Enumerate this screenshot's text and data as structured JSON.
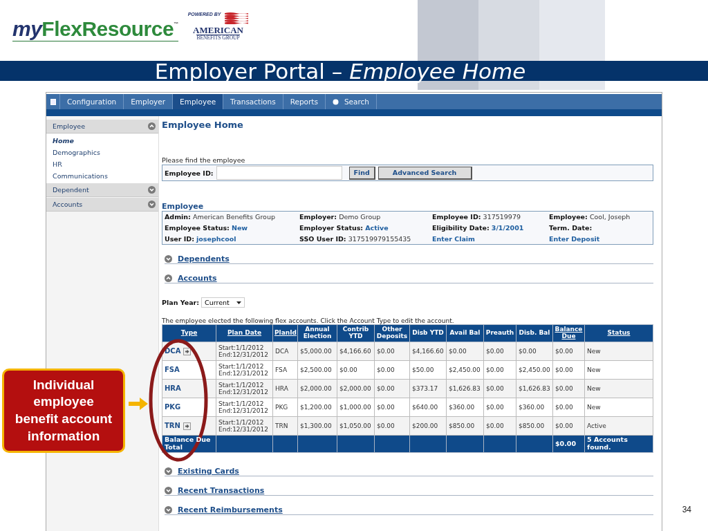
{
  "slide": {
    "logo": {
      "prefix": "my",
      "name": "FlexResource",
      "tm": "™"
    },
    "powered_by": "POWERED BY",
    "partner": [
      "AMERICAN",
      "BENEFITS GROUP"
    ],
    "title": "Employer Portal",
    "dash": "–",
    "subtitle": "Employee Home",
    "page_number": "34"
  },
  "callout": {
    "text": "Individual employee benefit account information"
  },
  "nav": {
    "tabs": [
      {
        "label": "Configuration",
        "selected": false,
        "kind": "tab"
      },
      {
        "label": "Employer",
        "selected": false,
        "kind": "tab"
      },
      {
        "label": "Employee",
        "selected": true,
        "kind": "tab"
      },
      {
        "label": "Transactions",
        "selected": false,
        "kind": "tab"
      },
      {
        "label": "Reports",
        "selected": false,
        "kind": "tab"
      },
      {
        "label": "Search",
        "selected": false,
        "kind": "search"
      }
    ]
  },
  "sidebar": {
    "groups": [
      {
        "label": "Employee",
        "expanded": true,
        "items": [
          {
            "label": "Home",
            "selected": true
          },
          {
            "label": "Demographics",
            "selected": false
          },
          {
            "label": "HR",
            "selected": false
          },
          {
            "label": "Communications",
            "selected": false
          }
        ]
      },
      {
        "label": "Dependent",
        "expanded": false
      },
      {
        "label": "Accounts",
        "expanded": false
      }
    ]
  },
  "content": {
    "heading": "Employee Home",
    "find": {
      "prompt": "Please find the employee",
      "label": "Employee ID:",
      "find_button": "Find",
      "advanced_button": "Advanced Search"
    },
    "employee": {
      "heading": "Employee",
      "fields": [
        {
          "label": "Admin:",
          "value": "American Benefits Group",
          "kind": "text"
        },
        {
          "label": "Employer:",
          "value": "Demo Group",
          "kind": "text"
        },
        {
          "label": "Employee ID:",
          "value": "317519979",
          "kind": "text"
        },
        {
          "label": "Employee:",
          "value": "Cool, Joseph",
          "kind": "text"
        },
        {
          "label": "Employee Status:",
          "value": "New",
          "kind": "status"
        },
        {
          "label": "Employer Status:",
          "value": "Active",
          "kind": "status"
        },
        {
          "label": "Eligibility Date:",
          "value": "3/1/2001",
          "kind": "status"
        },
        {
          "label": "Term. Date:",
          "kind": "text"
        },
        {
          "label": "User ID:",
          "value": "josephcool",
          "kind": "status"
        },
        {
          "label": "SSO User ID:",
          "value": "317519979155435",
          "kind": "text"
        },
        {
          "value": "Enter Claim",
          "kind": "link"
        },
        {
          "value": "Enter Deposit",
          "kind": "link"
        }
      ]
    },
    "sections": [
      {
        "label": "Dependents",
        "expanded": false
      },
      {
        "label": "Accounts",
        "expanded": true
      }
    ],
    "plan_year": {
      "label": "Plan Year:",
      "value": "Current"
    },
    "accounts_note": "The employee elected the following flex accounts. Click the Account Type to edit the account.",
    "table": {
      "columns": [
        {
          "label": "Type",
          "underlined": true
        },
        {
          "label": "Plan Date",
          "underlined": true
        },
        {
          "label": "PlanId",
          "underlined": true
        },
        {
          "label": "Annual Election",
          "underlined": false
        },
        {
          "label": "Contrib YTD",
          "underlined": false
        },
        {
          "label": "Other Deposits",
          "underlined": false
        },
        {
          "label": "Disb YTD",
          "underlined": false
        },
        {
          "label": "Avail Bal",
          "underlined": false
        },
        {
          "label": "Preauth",
          "underlined": false
        },
        {
          "label": "Disb. Bal",
          "underlined": false
        },
        {
          "label": "Balance Due",
          "underlined": true
        },
        {
          "label": "Status",
          "underlined": true
        }
      ],
      "rows": [
        {
          "add_icon": true,
          "cells": [
            "DCA",
            "Start:1/1/2012\nEnd:12/31/2012",
            "DCA",
            "$5,000.00",
            "$4,166.60",
            "$0.00",
            "$4,166.60",
            "$0.00",
            "$0.00",
            "$0.00",
            "$0.00",
            "New"
          ]
        },
        {
          "add_icon": false,
          "cells": [
            "FSA",
            "Start:1/1/2012\nEnd:12/31/2012",
            "FSA",
            "$2,500.00",
            "$0.00",
            "$0.00",
            "$50.00",
            "$2,450.00",
            "$0.00",
            "$2,450.00",
            "$0.00",
            "New"
          ]
        },
        {
          "add_icon": false,
          "cells": [
            "HRA",
            "Start:1/1/2012\nEnd:12/31/2012",
            "HRA",
            "$2,000.00",
            "$2,000.00",
            "$0.00",
            "$373.17",
            "$1,626.83",
            "$0.00",
            "$1,626.83",
            "$0.00",
            "New"
          ]
        },
        {
          "add_icon": false,
          "cells": [
            "PKG",
            "Start:1/1/2012\nEnd:12/31/2012",
            "PKG",
            "$1,200.00",
            "$1,000.00",
            "$0.00",
            "$640.00",
            "$360.00",
            "$0.00",
            "$360.00",
            "$0.00",
            "New"
          ]
        },
        {
          "add_icon": true,
          "cells": [
            "TRN",
            "Start:1/1/2012\nEnd:12/31/2012",
            "TRN",
            "$1,300.00",
            "$1,050.00",
            "$0.00",
            "$200.00",
            "$850.00",
            "$0.00",
            "$850.00",
            "$0.00",
            "Active"
          ]
        }
      ],
      "footer": {
        "label": "Balance Due Total",
        "balance": "$0.00",
        "count": "5 Accounts found."
      }
    },
    "more_sections": [
      {
        "label": "Existing Cards",
        "expanded": false
      },
      {
        "label": "Recent Transactions",
        "expanded": false
      },
      {
        "label": "Recent Reimbursements",
        "expanded": false
      }
    ]
  }
}
